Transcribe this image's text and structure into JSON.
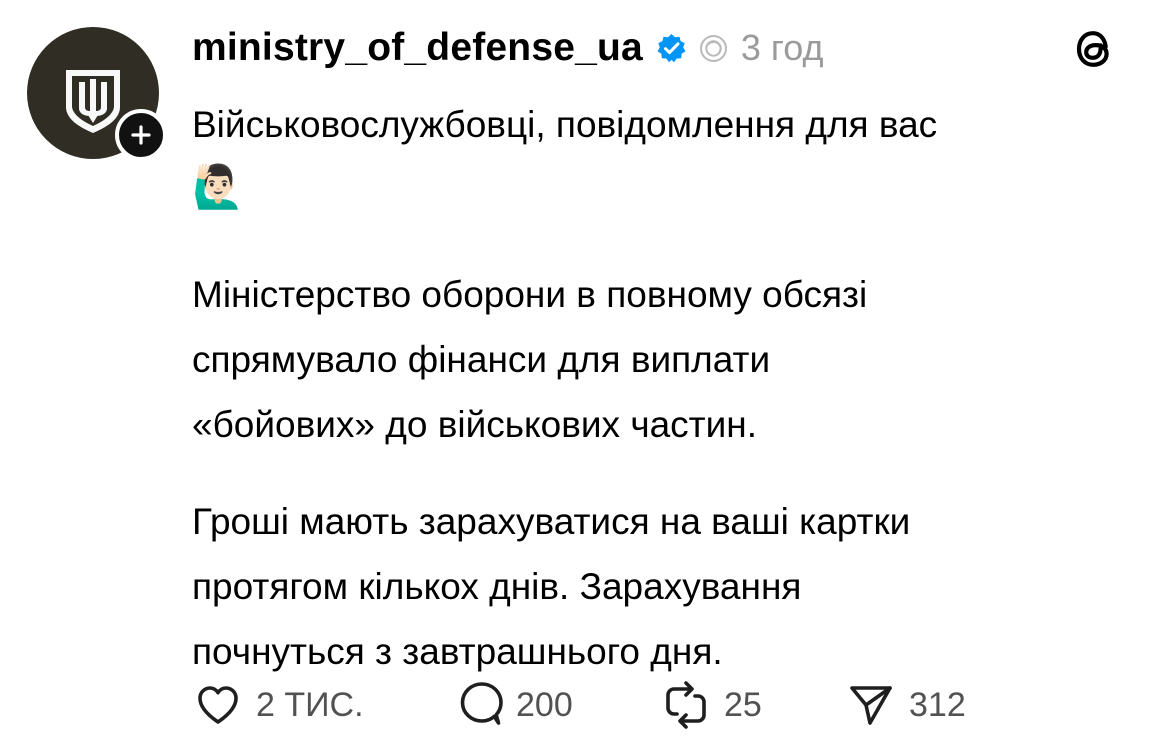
{
  "post": {
    "username": "ministry_of_defense_ua",
    "time": "3 год",
    "content": {
      "paragraph_1": "Військовослужбовці, повідомлення для вас",
      "emoji": "🙋🏻‍♂️",
      "paragraph_2_lines": [
        "Міністерство оборони в повному обсязі",
        "спрямувало фінанси для виплати",
        "«бойових» до військових частин."
      ],
      "paragraph_3_lines": [
        "Гроші мають зарахуватися на ваші картки",
        "протягом кількох днів. Зарахування",
        "почнуться з завтрашнього дня."
      ]
    },
    "actions": {
      "likes": "2 ТИС.",
      "comments": "200",
      "reposts": "25",
      "shares": "312"
    }
  },
  "colors": {
    "avatar_background": "#2f2d24",
    "avatar_emblem": "#f8f8f8",
    "verified_blue": "#0095f6",
    "text": "#000000",
    "muted_text": "#9a9a9a"
  },
  "icons": {
    "avatar": "ministry-emblem-icon",
    "follow": "plus-icon",
    "verified": "verified-badge-icon",
    "threads_meta": "threads-ring-icon",
    "app": "threads-logo-icon",
    "like": "heart-icon",
    "comment": "comment-bubble-icon",
    "repost": "repost-icon",
    "share": "send-icon"
  }
}
